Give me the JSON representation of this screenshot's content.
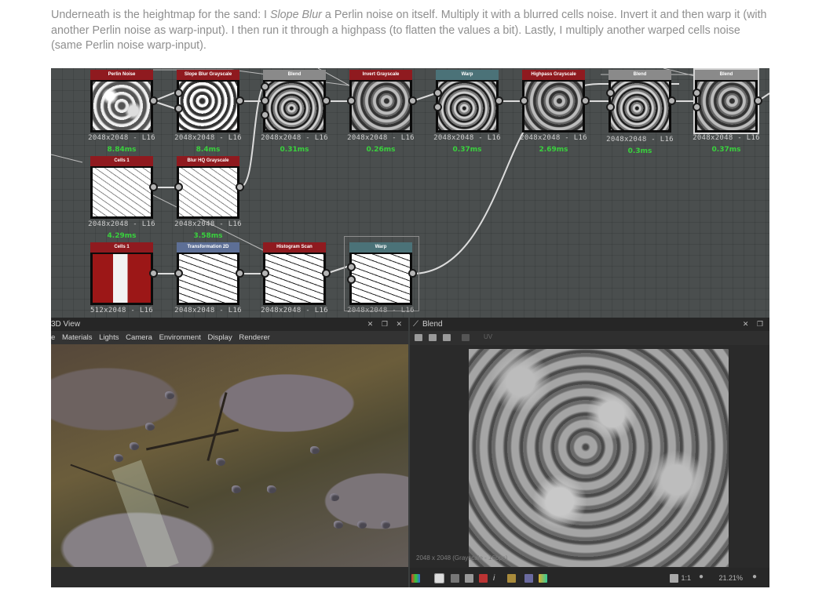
{
  "article": {
    "text_1": "Underneath is the heightmap for the sand: I ",
    "text_em": "Slope Blur",
    "text_2": " a Perlin noise on itself. Multiply it with a blurred cells noise. Invert it and then warp it (with another Perlin noise as warp-input). I then run it through a highpass (to flatten the values a bit). Lastly, I multiply another warped cells noise (same Perlin noise warp-input)."
  },
  "graph": {
    "nodes": [
      {
        "title": "Perlin Noise",
        "size": "2048x2048 - L16",
        "time": "8.84ms"
      },
      {
        "title": "Slope Blur Grayscale",
        "size": "2048x2048 - L16",
        "time": "8.4ms"
      },
      {
        "title": "Blend",
        "size": "2048x2048 - L16",
        "time": "0.31ms"
      },
      {
        "title": "Invert Grayscale",
        "size": "2048x2048 - L16",
        "time": "0.26ms"
      },
      {
        "title": "Warp",
        "size": "2048x2048 - L16",
        "time": "0.37ms"
      },
      {
        "title": "Highpass Grayscale",
        "size": "2048x2048 - L16",
        "time": "2.69ms"
      },
      {
        "title": "Blend",
        "size": "2048x2048 - L16",
        "time": "0.3ms"
      },
      {
        "title": "Blend",
        "size": "2048x2048 - L16",
        "time": "0.37ms"
      },
      {
        "title": "Cells 1",
        "size": "2048x2048 - L16",
        "time": "4.29ms"
      },
      {
        "title": "Blur HQ Grayscale",
        "size": "2048x2048 - L16",
        "time": "3.58ms"
      },
      {
        "title": "Cells 1",
        "size": "512x2048 - L16",
        "time": ""
      },
      {
        "title": "Transformation 2D",
        "size": "2048x2048 - L16",
        "time": ""
      },
      {
        "title": "Histogram Scan",
        "size": "2048x2048 - L16",
        "time": ""
      },
      {
        "title": "Warp",
        "size": "2048x2048 - L16",
        "time": ""
      }
    ]
  },
  "view3d": {
    "title": "3D View",
    "menu": [
      "e",
      "Materials",
      "Lights",
      "Camera",
      "Environment",
      "Display",
      "Renderer"
    ]
  },
  "blend_view": {
    "title": "Blend",
    "uv_label": "UV",
    "caption": "2048 x 2048 (Grayscale - 16bpc)",
    "ratio": "1:1",
    "zoom": "21.21%"
  },
  "colors": {
    "time_green": "#39d23d",
    "header_red": "#8f1a1f",
    "header_teal": "#4b7278",
    "header_blue": "#5d6f96"
  }
}
